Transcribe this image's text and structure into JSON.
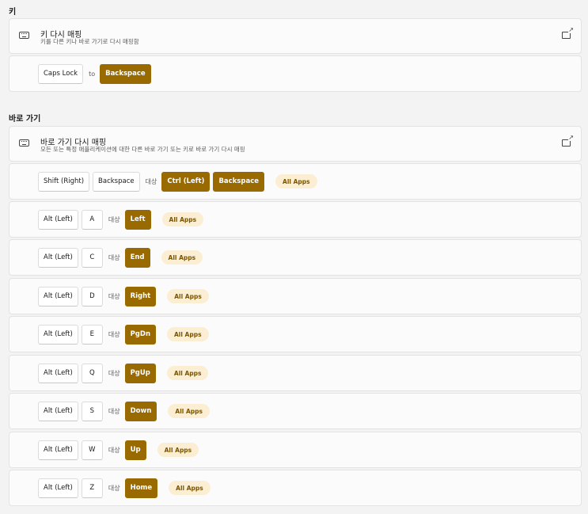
{
  "keys_section": {
    "title": "키",
    "card_title": "키 다시 매핑",
    "card_subtitle": "키를 다른 키나 바로 가기로 다시 매핑함",
    "remap": {
      "from": "Caps Lock",
      "sep": "to",
      "to": "Backspace"
    }
  },
  "shortcuts_section": {
    "title": "바로 가기",
    "card_title": "바로 가기 다시 매핑",
    "card_subtitle": "모든 또는 특정 애플리케이션에 대한 다른 바로 가기 또는 키로 바로 가기 다시 매핑",
    "rows": [
      {
        "from": [
          "Shift (Right)",
          "Backspace"
        ],
        "sep": "대상",
        "to": [
          "Ctrl (Left)",
          "Backspace"
        ],
        "apps": "All Apps"
      },
      {
        "from": [
          "Alt (Left)",
          "A"
        ],
        "sep": "대상",
        "to": [
          "Left"
        ],
        "apps": "All Apps"
      },
      {
        "from": [
          "Alt (Left)",
          "C"
        ],
        "sep": "대상",
        "to": [
          "End"
        ],
        "apps": "All Apps"
      },
      {
        "from": [
          "Alt (Left)",
          "D"
        ],
        "sep": "대상",
        "to": [
          "Right"
        ],
        "apps": "All Apps"
      },
      {
        "from": [
          "Alt (Left)",
          "E"
        ],
        "sep": "대상",
        "to": [
          "PgDn"
        ],
        "apps": "All Apps"
      },
      {
        "from": [
          "Alt (Left)",
          "Q"
        ],
        "sep": "대상",
        "to": [
          "PgUp"
        ],
        "apps": "All Apps"
      },
      {
        "from": [
          "Alt (Left)",
          "S"
        ],
        "sep": "대상",
        "to": [
          "Down"
        ],
        "apps": "All Apps"
      },
      {
        "from": [
          "Alt (Left)",
          "W"
        ],
        "sep": "대상",
        "to": [
          "Up"
        ],
        "apps": "All Apps"
      },
      {
        "from": [
          "Alt (Left)",
          "Z"
        ],
        "sep": "대상",
        "to": [
          "Home"
        ],
        "apps": "All Apps"
      }
    ]
  },
  "colors": {
    "accent": "#986a00",
    "apps_badge_bg": "#fbeed2",
    "apps_badge_text": "#7a5500"
  },
  "icons": [
    "keyboard-icon",
    "open-external-icon"
  ]
}
